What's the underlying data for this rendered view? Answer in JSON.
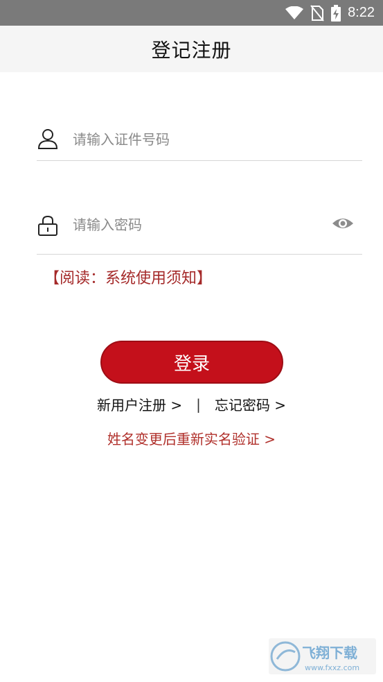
{
  "status_bar": {
    "time": "8:22",
    "icons": [
      "wifi-icon",
      "no-sim-icon",
      "battery-charging-icon"
    ]
  },
  "app_bar": {
    "title": "登记注册"
  },
  "form": {
    "id_field": {
      "placeholder": "请输入证件号码",
      "value": "",
      "icon": "user-icon"
    },
    "password_field": {
      "placeholder": "请输入密码",
      "value": "",
      "icon": "lock-icon",
      "toggle_icon": "eye-icon"
    }
  },
  "notice_link": "【阅读：系统使用须知】",
  "login_button": "登录",
  "links": {
    "register": "新用户注册 >",
    "separator": "|",
    "forgot_password": "忘记密码 >"
  },
  "rename_link": "姓名变更后重新实名验证 >",
  "watermark": {
    "text": "飞翔下载",
    "url_text": "www.fxxz.com"
  },
  "colors": {
    "status_bar": "#7a7a7a",
    "app_bar": "#f5f5f5",
    "primary": "#c4101b",
    "link_red": "#a52a2a"
  }
}
